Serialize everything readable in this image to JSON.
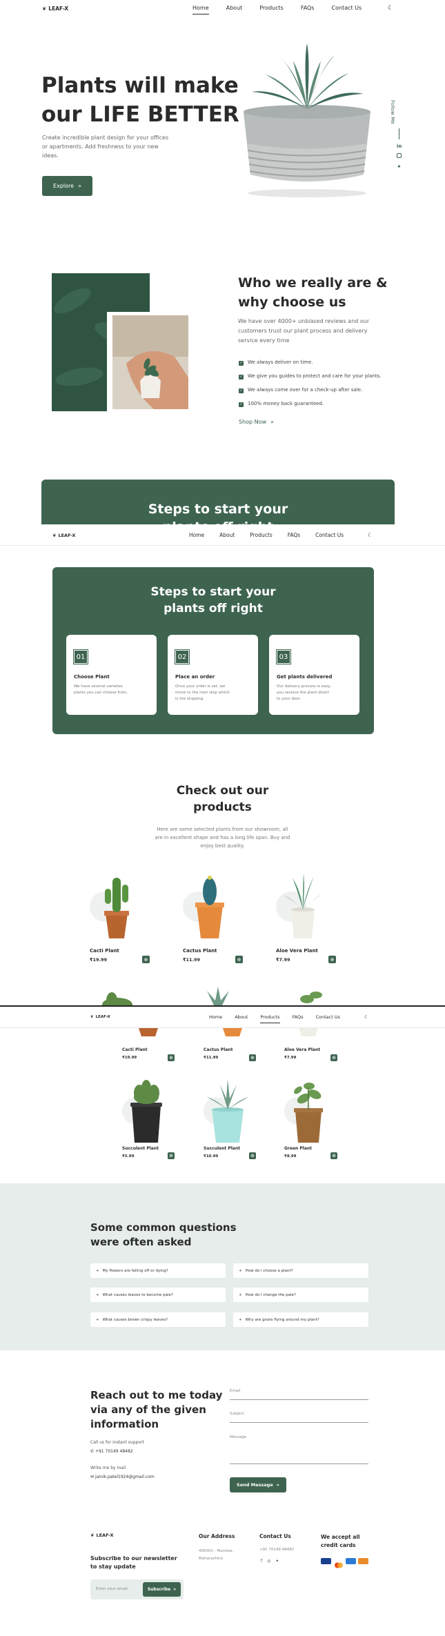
{
  "brand": {
    "name": "LEAF-X",
    "accent": "#3e6450"
  },
  "nav": {
    "links": [
      "Home",
      "About",
      "Products",
      "FAQs",
      "Contact Us"
    ],
    "theme_icon": "moon-icon"
  },
  "hero": {
    "title_line1": "Plants will make",
    "title_line2": "our LIFE BETTER",
    "desc_line1": "Create incredible plant design for your offices",
    "desc_line2": "or apartments. Add freshness to your new",
    "desc_line3": "ideas.",
    "cta": "Explore",
    "follow": "Follow Me",
    "social_icons": [
      "linkedin-icon",
      "instagram-icon",
      "twitter-icon"
    ]
  },
  "about": {
    "title_line1": "Who we really are &",
    "title_line2": "why choose us",
    "desc_line1": "We have over 4000+ unbiased reviews and our",
    "desc_line2": "customers trust our plant process and delivery",
    "desc_line3": "service every time",
    "points": [
      "We always deliver on time.",
      "We give you guides to protect and care for your plants.",
      "We always come over for a check-up after sale.",
      "100% money back guaranteed."
    ],
    "cta": "Shop Now"
  },
  "steps": {
    "title_line1": "Steps to start your",
    "title_line2": "plants off right",
    "clipped_line2": "plants off right",
    "items": [
      {
        "num": "01",
        "title": "Choose Plant",
        "l1": "We have several varieties",
        "l2": "plants you can choose from.",
        "l3": ""
      },
      {
        "num": "02",
        "title": "Place an order",
        "l1": "Once your order is set, we",
        "l2": "move to the next step which",
        "l3": "is the shipping."
      },
      {
        "num": "03",
        "title": "Get plants delivered",
        "l1": "Our delivery process is easy,",
        "l2": "you receive the plant direct",
        "l3": "to your door."
      }
    ]
  },
  "products": {
    "title_line1": "Check out our",
    "title_line2": "products",
    "desc_line1": "Here are some selected plants from our showroom, all",
    "desc_line2": "are in excellent shape and has a long life span. Buy and",
    "desc_line3": "enjoy best quality.",
    "items": [
      {
        "name": "Cacti Plant",
        "price": "₹19.99"
      },
      {
        "name": "Cactus Plant",
        "price": "₹11.99"
      },
      {
        "name": "Aloe Vera Plant",
        "price": "₹7.99"
      },
      {
        "name": "Succulent Plant",
        "price": "₹5.99"
      },
      {
        "name": "Succulent Plant",
        "price": "₹10.99"
      },
      {
        "name": "Green Plant",
        "price": "₹8.99"
      }
    ]
  },
  "faq": {
    "title_line1": "Some common questions",
    "title_line2": "were often asked",
    "items": [
      "My flowers are falling off or dying?",
      "How do i choose a plant?",
      "What causes leaves to become pale?",
      "How do I change the pale?",
      "What causes brown crispy leaves?",
      "Why are gnats flying around my plant?"
    ]
  },
  "contact": {
    "title_line1": "Reach out to me today",
    "title_line2": "via any of the given",
    "title_line3": "information",
    "support_label": "Call us for instant support",
    "phone": "+91 70149 48482",
    "mail_label": "Write me by mail",
    "email": "jainik.patel1924@gmail.com",
    "email_placeholder": "Email",
    "subject_placeholder": "Subject",
    "message_placeholder": "Message",
    "send": "Send Message"
  },
  "footer": {
    "newsletter_line1": "Subscribe to our newsletter",
    "newsletter_line2": "to stay update",
    "email_placeholder": "Enter your email",
    "subscribe": "Subscribe",
    "address_title": "Our Address",
    "address_line1": "400001 - Mumbai,",
    "address_line2": "Maharashtra",
    "contact_title": "Contact Us",
    "contact_phone": "+91 70149 48482",
    "cards_title_line1": "We accept all",
    "cards_title_line2": "credit cards",
    "social_icons": [
      "facebook-icon",
      "instagram-icon",
      "twitter-icon"
    ],
    "card_brands": [
      "visa",
      "mastercard",
      "paypal",
      "discover"
    ],
    "card_colors": [
      "#1a3f8f",
      "#e94b1c",
      "#2b7bd6",
      "#e98b2a"
    ]
  }
}
